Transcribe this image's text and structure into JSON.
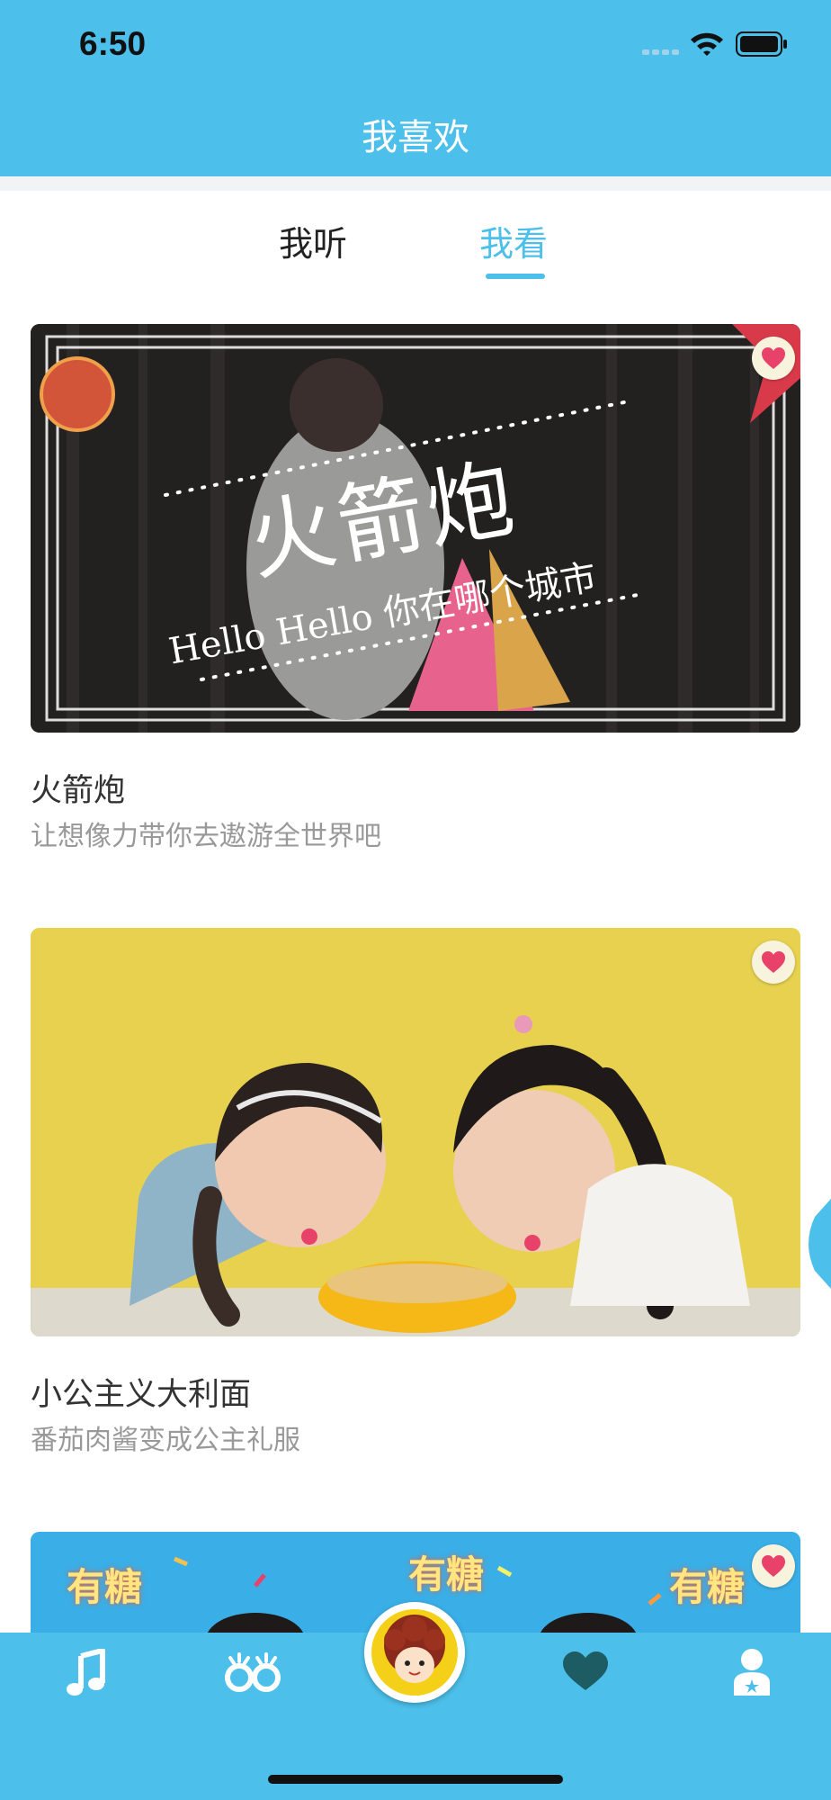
{
  "status_bar": {
    "time": "6:50"
  },
  "header": {
    "title": "我喜欢"
  },
  "tabs": {
    "listen": "我听",
    "watch": "我看",
    "active": "watch"
  },
  "cards": [
    {
      "title": "火箭炮",
      "subtitle": "让想像力带你去遨游全世界吧",
      "overlay_title": "火箭炮",
      "overlay_caption": "Hello Hello 你在哪个城市",
      "favorited": true
    },
    {
      "title": "小公主义大利面",
      "subtitle": "番茄肉酱变成公主礼服",
      "favorited": true
    },
    {
      "title": "",
      "subtitle": "",
      "overlay_labels": [
        "有糖",
        "有糖",
        "有糖"
      ],
      "favorited": true
    }
  ],
  "tab_bar": {
    "items": [
      {
        "icon": "music-note-icon"
      },
      {
        "icon": "eyes-icon"
      },
      {
        "icon": "avatar-icon"
      },
      {
        "icon": "heart-icon",
        "active": true
      },
      {
        "icon": "profile-icon"
      }
    ]
  },
  "colors": {
    "primary": "#4cbfea",
    "heart": "#e8426a",
    "tab_active": "#1d5c63"
  }
}
